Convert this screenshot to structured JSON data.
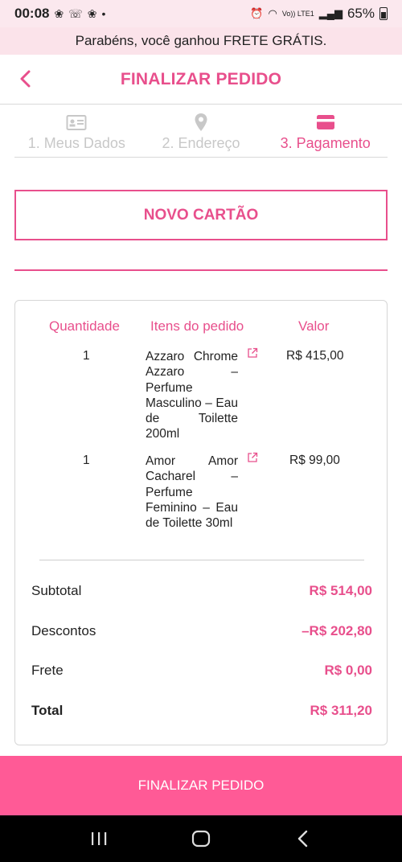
{
  "status_bar": {
    "time": "00:08",
    "battery": "65%",
    "network": "Vo)) LTE1"
  },
  "promo": {
    "text": "Parabéns, você ganhou  FRETE GRÁTIS."
  },
  "header": {
    "title": "FINALIZAR PEDIDO"
  },
  "steps": [
    {
      "label": "1. Meus Dados",
      "icon": "id-card-icon"
    },
    {
      "label": "2. Endereço",
      "icon": "location-pin-icon"
    },
    {
      "label": "3. Pagamento",
      "icon": "credit-card-icon"
    }
  ],
  "new_card_button": {
    "label": "NOVO CARTÃO"
  },
  "order": {
    "columns": {
      "quantity": "Quantidade",
      "items": "Itens do pedido",
      "value": "Valor"
    },
    "items": [
      {
        "qty": "1",
        "name": "Azzaro Chrome Azzaro – Perfume Masculino – Eau de Toilette 200ml",
        "price": "R$ 415,00"
      },
      {
        "qty": "1",
        "name": "Amor Amor Cacharel – Perfume Feminino – Eau de Toilette 30ml",
        "price": "R$ 99,00"
      }
    ],
    "subtotal": {
      "label": "Subtotal",
      "value": "R$ 514,00"
    },
    "discounts": {
      "label": "Descontos",
      "value": "–R$ 202,80"
    },
    "shipping": {
      "label": "Frete",
      "value": "R$ 0,00"
    },
    "total": {
      "label": "Total",
      "value": "R$ 311,20"
    }
  },
  "finalize_button": {
    "label": "FINALIZAR PEDIDO"
  },
  "colors": {
    "accent": "#e84f8c",
    "button": "#ff5a96",
    "promo_bg": "#fbe3ea"
  }
}
